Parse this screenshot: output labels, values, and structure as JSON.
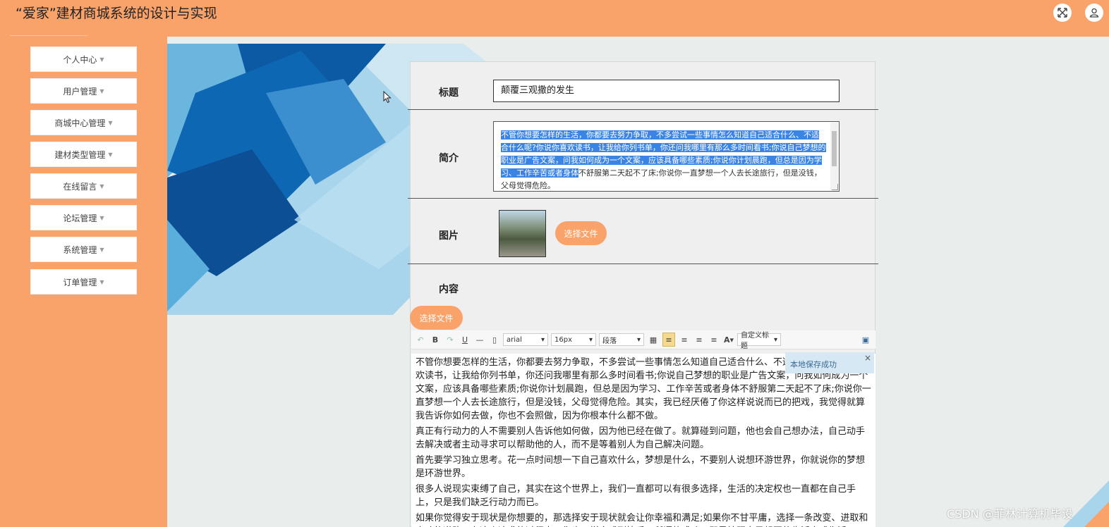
{
  "header": {
    "title": "“爱家”建材商城系统的设计与实现",
    "fullscreen_icon": "fullscreen-icon",
    "user_icon": "user-icon"
  },
  "sidebar": {
    "items": [
      {
        "label": "个人中心"
      },
      {
        "label": "用户管理"
      },
      {
        "label": "商城中心管理"
      },
      {
        "label": "建材类型管理"
      },
      {
        "label": "在线留言"
      },
      {
        "label": "论坛管理"
      },
      {
        "label": "系统管理"
      },
      {
        "label": "订单管理"
      }
    ]
  },
  "form": {
    "title_label": "标题",
    "title_value": "颠覆三观撒的发生",
    "intro_label": "简介",
    "intro_selected": "不管你想要怎样的生活，你都要去努力争取，不多尝试一些事情怎么知道自己适合什么、不适合什么呢?你说你喜欢读书，让我给你列书单，你还问我哪里有那么多时间看书;你说自己梦想的职业是广告文案，问我如何成为一个文案，应该具备哪些素质;你说你计划晨跑，但总是因为学习、工作辛苦或者身体",
    "intro_rest": "不舒服第二天起不了床;你说你一直梦想一个人去长途旅行，但是没钱，父母觉得危险。",
    "image_label": "图片",
    "image_button": "选择文件",
    "content_label": "内容",
    "content_button": "选择文件"
  },
  "toolbar": {
    "font": "arial",
    "size": "16px",
    "paragraph": "段落",
    "custom_title": "自定义标题"
  },
  "toast": {
    "text": "本地保存成功",
    "close": "×"
  },
  "editor": {
    "paragraphs": [
      "不管你想要怎样的生活，你都要去努力争取，不多尝试一些事情怎么知道自己适合什么、不适合什么呢?你说你喜欢读书，让我给你列书单，你还问我哪里有那么多时间看书;你说自己梦想的职业是广告文案，问我如何成为一个文案，应该具备哪些素质;你说你计划晨跑，但总是因为学习、工作辛苦或者身体不舒服第二天起不了床;你说你一直梦想一个人去长途旅行，但是没钱，父母觉得危险。其实，我已经厌倦了你这样说说而已的把戏，我觉得就算我告诉你如何去做，你也不会照做，因为你根本什么都不做。",
      "真正有行动力的人不需要别人告诉他如何做，因为他已经在做了。就算碰到问题，他也会自己想办法，自己动手去解决或者主动寻求可以帮助他的人，而不是等着别人为自己解决问题。",
      "首先要学习独立思考。花一点时间想一下自己喜欢什么，梦想是什么，不要别人说想环游世界，你就说你的梦想是环游世界。",
      "很多人说现实束缚了自己，其实在这个世界上，我们一直都可以有很多选择，生活的决定权也一直都在自己手上，只是我们缺乏行动力而已。",
      "如果你觉得安于现状是你想要的，那选择安于现状就会让你幸福和满足;如果你不甘平庸，选择一条改变、进取和奋斗的道路，在这个追求的过程中，你也一样会感到快乐。所谓的成功，即是按照自己想要的生活方式生活。"
    ]
  },
  "watermark": "CSDN @菲林计算机毕设",
  "colors": {
    "brand_orange": "#f9a36b",
    "selection_blue": "#3c84e3",
    "deco_dark_blue": "#0b5aa3"
  }
}
